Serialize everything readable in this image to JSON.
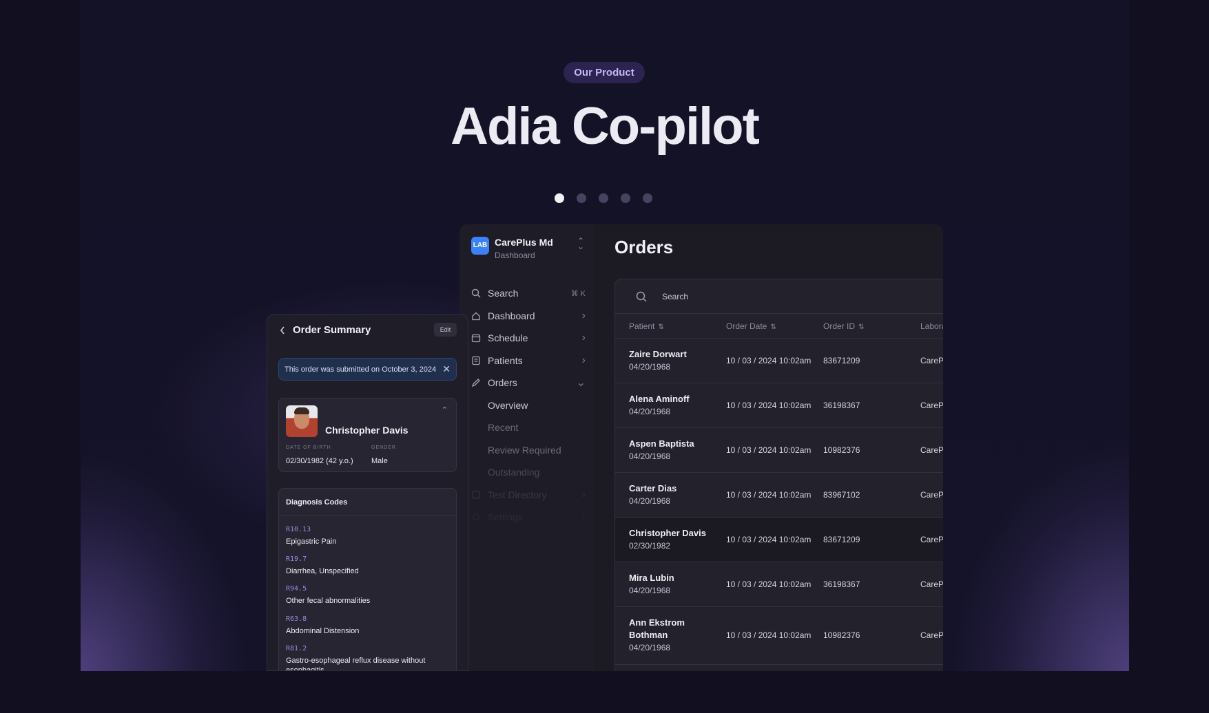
{
  "hero": {
    "badge": "Our Product",
    "title": "Adia Co-pilot",
    "slide_count": 5,
    "active_slide": 1
  },
  "brand": {
    "logo": "LAB",
    "name": "CarePlus Md",
    "subtitle": "Dashboard"
  },
  "sidebar": {
    "search": {
      "label": "Search",
      "shortcut": "⌘ K"
    },
    "items": [
      {
        "label": "Dashboard",
        "icon": "home-icon"
      },
      {
        "label": "Schedule",
        "icon": "calendar-icon"
      },
      {
        "label": "Patients",
        "icon": "patients-icon"
      },
      {
        "label": "Orders",
        "icon": "pen-icon",
        "expanded": true
      },
      {
        "label": "Test Directory",
        "icon": "directory-icon"
      },
      {
        "label": "Settings",
        "icon": "gear-icon"
      }
    ],
    "orders_sub": [
      "Overview",
      "Recent",
      "Review Required",
      "Outstanding"
    ]
  },
  "orders": {
    "title": "Orders",
    "search_placeholder": "Search",
    "columns": [
      "Patient",
      "Order Date",
      "Order ID",
      "Labora"
    ],
    "rows": [
      {
        "name": "Zaire Dorwart",
        "dob": "04/20/1968",
        "date": "10 / 03 / 2024 10:02am",
        "id": "83671209",
        "lab": "CareP"
      },
      {
        "name": "Alena Aminoff",
        "dob": "04/20/1968",
        "date": "10 / 03 / 2024 10:02am",
        "id": "36198367",
        "lab": "CareP"
      },
      {
        "name": "Aspen Baptista",
        "dob": "04/20/1968",
        "date": "10 / 03 / 2024 10:02am",
        "id": "10982376",
        "lab": "CareP"
      },
      {
        "name": "Carter Dias",
        "dob": "04/20/1968",
        "date": "10 / 03 / 2024 10:02am",
        "id": "83967102",
        "lab": "CareP"
      },
      {
        "name": "Christopher Davis",
        "dob": "02/30/1982",
        "date": "10 / 03 / 2024 10:02am",
        "id": "83671209",
        "lab": "CareP"
      },
      {
        "name": "Mira Lubin",
        "dob": "04/20/1968",
        "date": "10 / 03 / 2024 10:02am",
        "id": "36198367",
        "lab": "CareP"
      },
      {
        "name": "Ann Ekstrom Bothman",
        "name_line1": "Ann Ekstrom",
        "name_line2": "Bothman",
        "dob": "04/20/1968",
        "date": "10 / 03 / 2024 10:02am",
        "id": "10982376",
        "lab": "CareP"
      }
    ]
  },
  "summary": {
    "title": "Order Summary",
    "edit": "Edit",
    "notice": "This order was submitted on October 3, 2024",
    "patient": {
      "name": "Christopher Davis",
      "dob_label": "DATE OF BIRTH",
      "dob": "02/30/1982 (42 y.o.)",
      "gender_label": "GENDER",
      "gender": "Male"
    },
    "diagnosis_title": "Diagnosis Codes",
    "diagnoses": [
      {
        "code": "R10.13",
        "desc": "Epigastric Pain"
      },
      {
        "code": "R19.7",
        "desc": "Diarrhea, Unspecified"
      },
      {
        "code": "R94.5",
        "desc": "Other fecal abnormalities"
      },
      {
        "code": "R63.8",
        "desc": "Abdominal Distension"
      },
      {
        "code": "R81.2",
        "desc": "Gastro-esophageal reflux disease without esophagitis"
      }
    ]
  }
}
